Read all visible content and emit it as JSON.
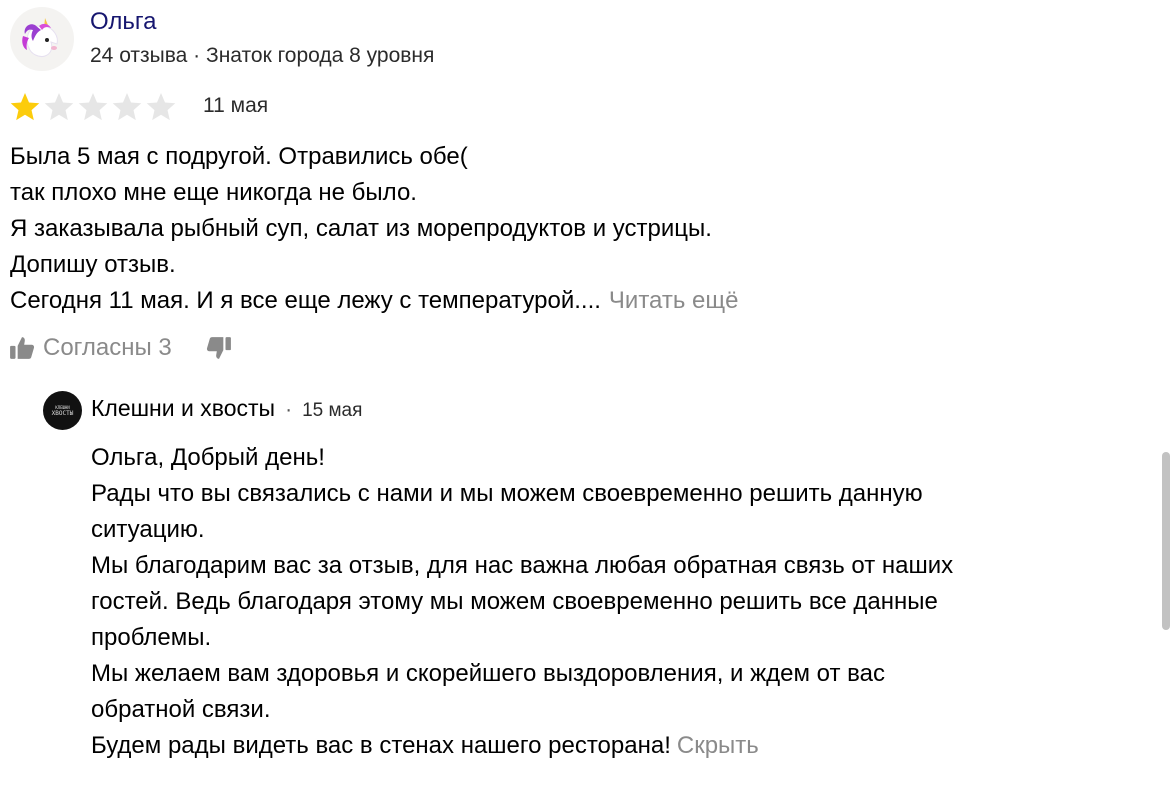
{
  "review": {
    "author_name": "Ольга",
    "author_meta": "24 отзыва · Знаток города 8 уровня",
    "rating": 1,
    "rating_max": 5,
    "date": "11 мая",
    "text_lines": [
      "Была 5 мая с подругой. Отравились обе(",
      "так плохо мне еще никогда не было.",
      "Я заказывала рыбный суп, салат из морепродуктов и устрицы.",
      "Допишу отзыв.",
      "Сегодня 11 мая. И я все еще лежу с температурой...."
    ],
    "read_more": "Читать ещё",
    "agree_label": "Согласны 3"
  },
  "reply": {
    "author_name": "Клешни и хвосты",
    "separator": "·",
    "date": "15 мая",
    "avatar_text": [
      "КЛЕШНИ",
      "ХВОСТЫ"
    ],
    "text_lines": [
      "Ольга, Добрый день!",
      "Рады что вы связались с нами и мы можем своевременно решить данную",
      "ситуацию.",
      "Мы благодарим вас за отзыв, для нас важна любая обратная связь от наших",
      "гостей. Ведь благодаря этому мы можем своевременно решить все данные",
      "проблемы.",
      "Мы желаем вам здоровья и скорейшего выздоровления, и ждем от вас",
      "обратной связи.",
      "Будем рады видеть вас в стенах нашего ресторана!"
    ],
    "hide_label": "Скрыть"
  },
  "icons": {
    "avatar": "unicorn-icon",
    "star": "star-icon",
    "like": "thumbs-up-icon",
    "dislike": "thumbs-down-icon"
  },
  "colors": {
    "star_filled": "#fccc0c",
    "star_empty": "#e6e6e6",
    "author_name": "#16166f",
    "muted": "#8a8a8a"
  }
}
